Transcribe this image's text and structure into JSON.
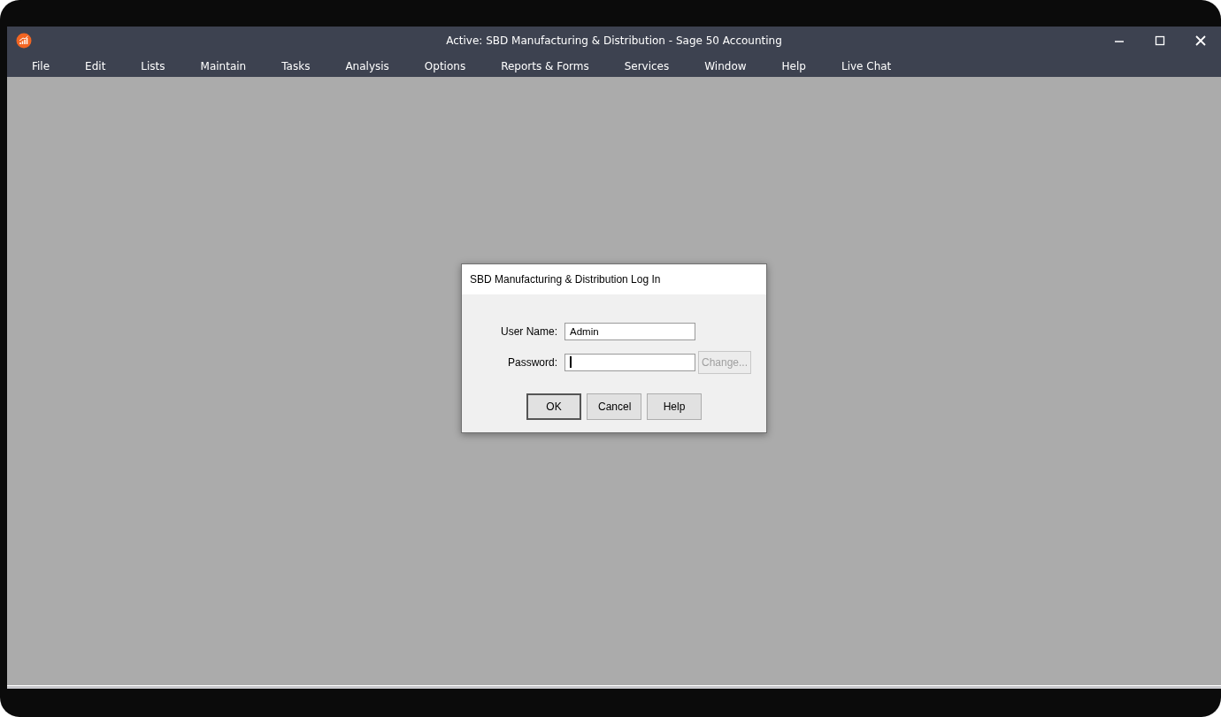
{
  "window": {
    "title": "Active: SBD Manufacturing & Distribution - Sage 50 Accounting"
  },
  "menu": [
    "File",
    "Edit",
    "Lists",
    "Maintain",
    "Tasks",
    "Analysis",
    "Options",
    "Reports & Forms",
    "Services",
    "Window",
    "Help",
    "Live Chat"
  ],
  "dialog": {
    "title": "SBD Manufacturing & Distribution Log In",
    "fields": [
      {
        "label": "User Name:",
        "value": "Admin",
        "focused": false
      },
      {
        "label": "Password:",
        "focused": true,
        "button": {
          "label": "Change...",
          "disabled": true
        }
      }
    ],
    "buttons": [
      {
        "label": "OK",
        "default": true
      },
      {
        "label": "Cancel",
        "default": false
      },
      {
        "label": "Help",
        "default": false
      }
    ]
  }
}
